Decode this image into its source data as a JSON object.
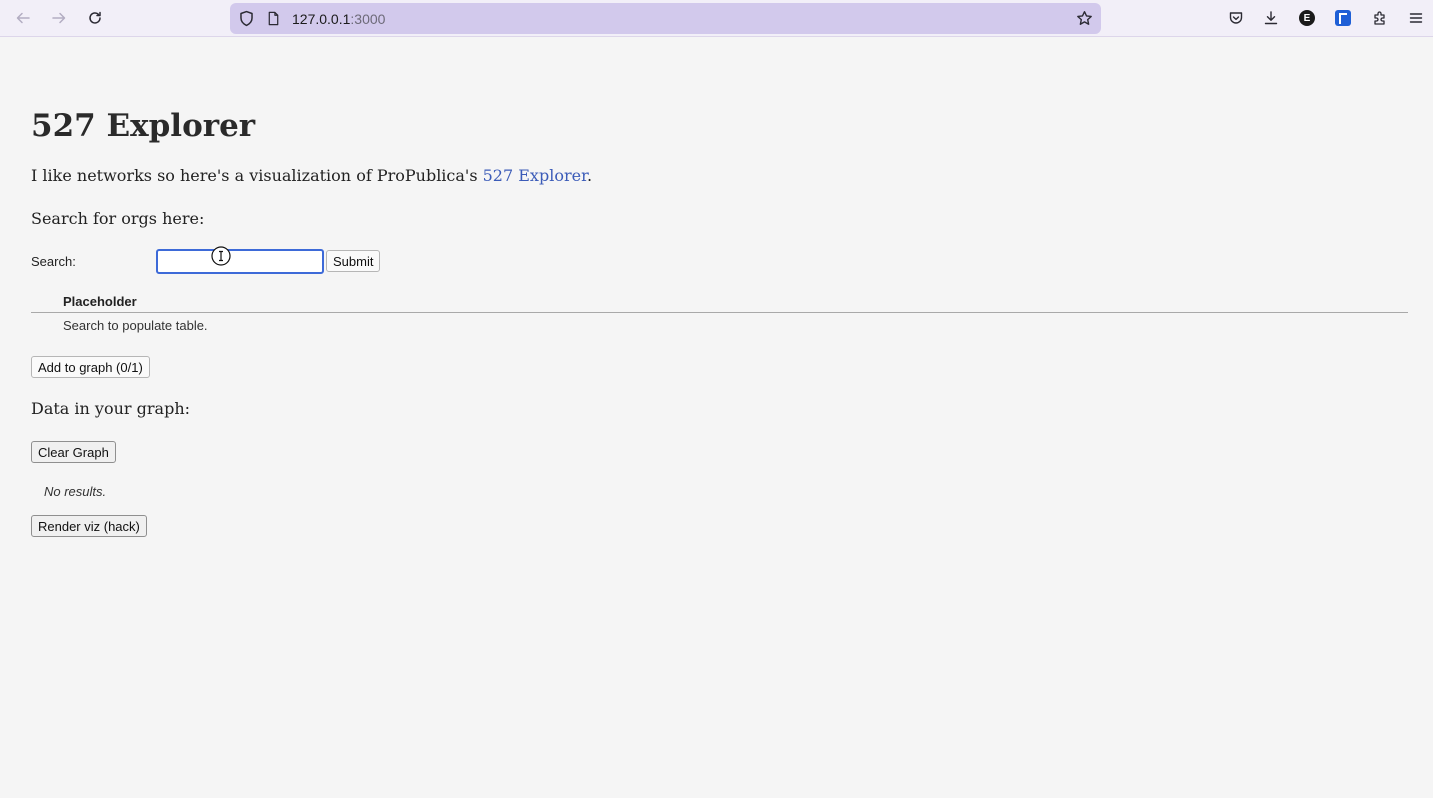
{
  "browser": {
    "url_host": "127.0.0.1",
    "url_port": ":3000"
  },
  "page": {
    "title": "527 Explorer",
    "intro_prefix": "I like networks so here's a visualization of ProPublica's ",
    "intro_link": "527 Explorer",
    "intro_suffix": ".",
    "search_heading": "Search for orgs here:",
    "search_label": "Search:",
    "search_value": "",
    "submit_label": "Submit",
    "table": {
      "header": "Placeholder",
      "empty_message": "Search to populate table."
    },
    "add_to_graph_label": "Add to graph (0/1)",
    "graph_heading": "Data in your graph:",
    "clear_graph_label": "Clear Graph",
    "no_results": "No results.",
    "render_label": "Render viz (hack)"
  },
  "colors": {
    "link": "#3b5bb8",
    "focus_ring": "#3d6ad8",
    "urlbar": "#d2c9ec"
  }
}
